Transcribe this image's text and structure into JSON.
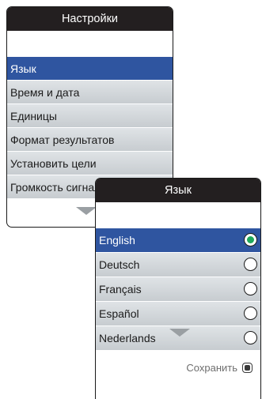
{
  "settings_screen": {
    "title": "Настройки",
    "items": [
      {
        "label": "Язык",
        "selected": true
      },
      {
        "label": "Время и дата",
        "selected": false
      },
      {
        "label": "Единицы",
        "selected": false
      },
      {
        "label": "Формат результатов",
        "selected": false
      },
      {
        "label": "Установить цели",
        "selected": false
      },
      {
        "label": "Громкость сигнала",
        "selected": false
      }
    ]
  },
  "language_screen": {
    "title": "Язык",
    "items": [
      {
        "label": "English",
        "selected": true
      },
      {
        "label": "Deutsch",
        "selected": false
      },
      {
        "label": "Français",
        "selected": false
      },
      {
        "label": "Español",
        "selected": false
      },
      {
        "label": "Nederlands",
        "selected": false
      }
    ],
    "save_label": "Сохранить"
  },
  "colors": {
    "titlebar": "#231f20",
    "selected_row": "#2f55a0",
    "radio_checked": "#1fa85a",
    "arrow": "#9a9fa3"
  }
}
